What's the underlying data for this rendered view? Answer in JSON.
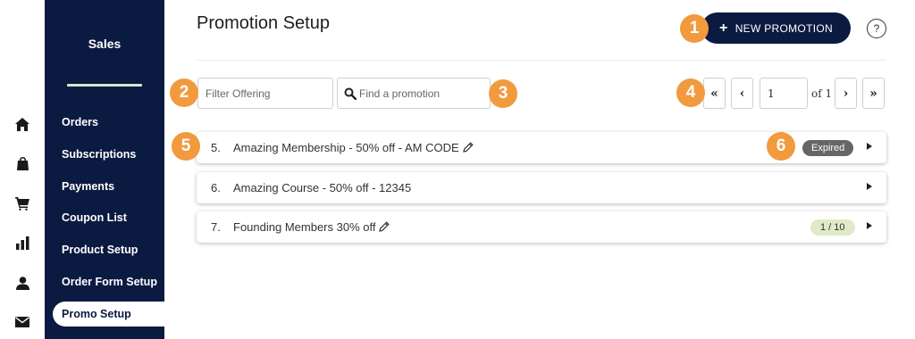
{
  "icon_rail": [
    "home-icon",
    "store-icon",
    "cart-icon",
    "bar-chart-icon",
    "user-icon",
    "mail-icon"
  ],
  "sidebar": {
    "title": "Sales",
    "items": [
      {
        "label": "Orders"
      },
      {
        "label": "Subscriptions"
      },
      {
        "label": "Payments"
      },
      {
        "label": "Coupon List"
      },
      {
        "label": "Product Setup"
      },
      {
        "label": "Order Form Setup"
      },
      {
        "label": "Promo Setup",
        "active": true
      }
    ]
  },
  "header": {
    "title": "Promotion Setup",
    "new_button_label": "NEW PROMOTION",
    "help_label": "?"
  },
  "filters": {
    "offering_placeholder": "Filter Offering",
    "search_placeholder": "Find a promotion"
  },
  "pagination": {
    "first": "«",
    "prev": "‹",
    "page_value": "1",
    "of_label": "of 1",
    "next": "›",
    "last": "»"
  },
  "promotions": [
    {
      "number": "5.",
      "name": "Amazing Membership - 50% off - AM CODE",
      "editable": true,
      "badge": "Expired"
    },
    {
      "number": "6.",
      "name": "Amazing Course - 50% off - 12345",
      "editable": false,
      "badge": ""
    },
    {
      "number": "7.",
      "name": "Founding Members 30% off",
      "editable": true,
      "badge": "1 / 10"
    }
  ],
  "callouts": [
    "1",
    "2",
    "3",
    "4",
    "5",
    "6"
  ],
  "colors": {
    "sidebar_bg": "#0b1a40",
    "primary_button": "#0b1a40",
    "callout": "#f19a3e",
    "expired_badge": "#666666",
    "count_badge": "#dfeac6"
  }
}
